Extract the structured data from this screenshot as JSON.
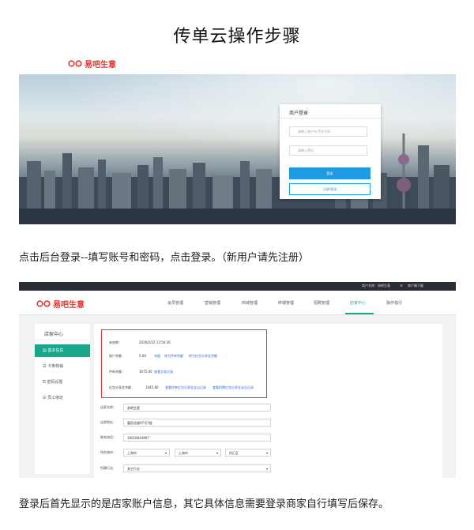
{
  "title": "传单云操作步骤",
  "logo": {
    "text": "易吧生意",
    "brand_color": "#e8322c"
  },
  "login_screen": {
    "card_title": "商户登录",
    "username_placeholder": "请输入商户名/手机号码",
    "password_placeholder": "请输入密码",
    "login_button": "登录",
    "register_button": "注册/登录"
  },
  "instruction_1": "点击后台登录--填写账号和密码，点击登录。（新用户请先注册）",
  "dashboard": {
    "topbar": {
      "account": "商户名称：易吧生意",
      "download": "商户端下载"
    },
    "nav": [
      "会员管理",
      "营销管理",
      "商城管理",
      "终端管理",
      "招聘管理",
      "店家中心",
      "操作指引"
    ],
    "nav_active_index": 5,
    "accent": "#1aa688",
    "sidebar": {
      "title": "店家中心",
      "items": [
        "基本信息",
        "卡券核销",
        "密码设置",
        "员工绑定"
      ],
      "active_index": 0
    },
    "account_box": {
      "expiry_label": "有效期：",
      "expiry_value": "2029/2/22 13:50:36",
      "balance_label": "账户余额：",
      "balance_value": "5.00",
      "balance_links": [
        "充值",
        "转为传单余额",
        "转为红包分享金余额"
      ],
      "flyer_label": "传单余额：",
      "flyer_value": "3075.00",
      "flyer_link": "查看交易记录",
      "redpack_label": "红包分享金余额：",
      "redpack_value": "1445.80",
      "redpack_links": [
        "查看传单红包分享金支出记录",
        "查看招聘红包分享金支出记录"
      ]
    },
    "fields": {
      "store_name_label": "店家名称：",
      "store_name_value": "易吧生意",
      "address_label": "店家地址：",
      "address_value": "襄阳北路97号7楼",
      "phone_label": "联系电话：",
      "phone_value": "18018644897",
      "city_label": "所在城市：",
      "province_value": "上海市",
      "city_value": "上海市",
      "district_value": "徐汇区",
      "industry_label": "所属行业：",
      "industry_value": "其它行业"
    }
  },
  "instruction_2": "登录后首先显示的是店家账户信息，其它具体信息需要登录商家自行填写后保存。"
}
